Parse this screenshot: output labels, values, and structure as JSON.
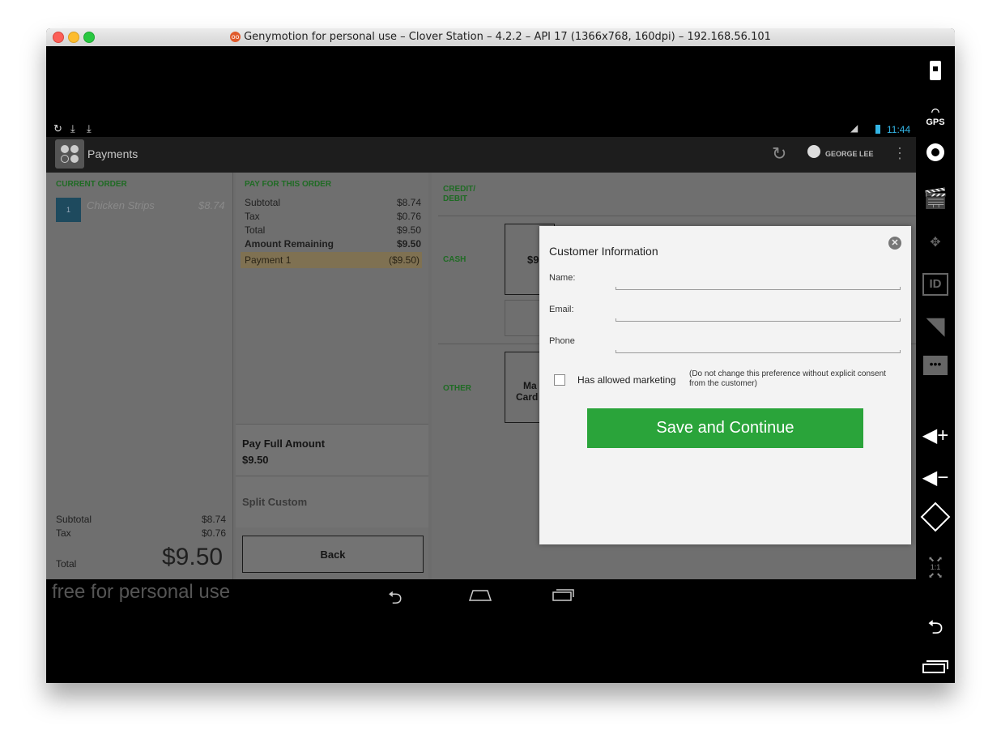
{
  "window": {
    "title": "Genymotion for personal use – Clover Station – 4.2.2 – API 17 (1366x768, 160dpi) – 192.168.56.101",
    "title_icon": "oo"
  },
  "status_bar": {
    "time": "11:44"
  },
  "action_bar": {
    "title": "Payments",
    "user": "GEORGE LEE"
  },
  "current_order": {
    "heading": "CURRENT ORDER",
    "item_qty": "1",
    "item_name": "Chicken Strips",
    "item_price": "$8.74",
    "subtotal_label": "Subtotal",
    "subtotal": "$8.74",
    "tax_label": "Tax",
    "tax": "$0.76",
    "total_label": "Total",
    "total": "$9.50"
  },
  "pay_order": {
    "heading": "PAY FOR THIS ORDER",
    "rows": [
      {
        "label": "Subtotal",
        "value": "$8.74"
      },
      {
        "label": "Tax",
        "value": "$0.76"
      },
      {
        "label": "Total",
        "value": "$9.50"
      },
      {
        "label": "Amount Remaining",
        "value": "$9.50"
      },
      {
        "label": "Payment 1",
        "value": "($9.50)"
      }
    ],
    "pay_full_label": "Pay Full Amount",
    "pay_full_amount": "$9.50",
    "split_label": "Split Custom",
    "back_label": "Back"
  },
  "tenders": {
    "credit_label": "CREDIT/\nDEBIT",
    "cash_label": "CASH",
    "cash_button_partial": "$9",
    "other_label": "OTHER",
    "other_button_line1": "Ma",
    "other_button_line2": "Card"
  },
  "modal": {
    "title": "Customer Information",
    "name_label": "Name:",
    "email_label": "Email:",
    "phone_label": "Phone",
    "marketing_label": "Has allowed marketing",
    "marketing_note": "(Do not change this preference without explicit consent from the customer)",
    "save_label": "Save and Continue"
  },
  "watermark": "free for personal use",
  "sidebar": {
    "gps_label": "GPS",
    "id_label": "ID",
    "ratio_label": "1:1"
  },
  "colors": {
    "accent_green": "#2aa43a",
    "heading_green": "#1f6b24",
    "status_blue": "#33b5e5"
  }
}
